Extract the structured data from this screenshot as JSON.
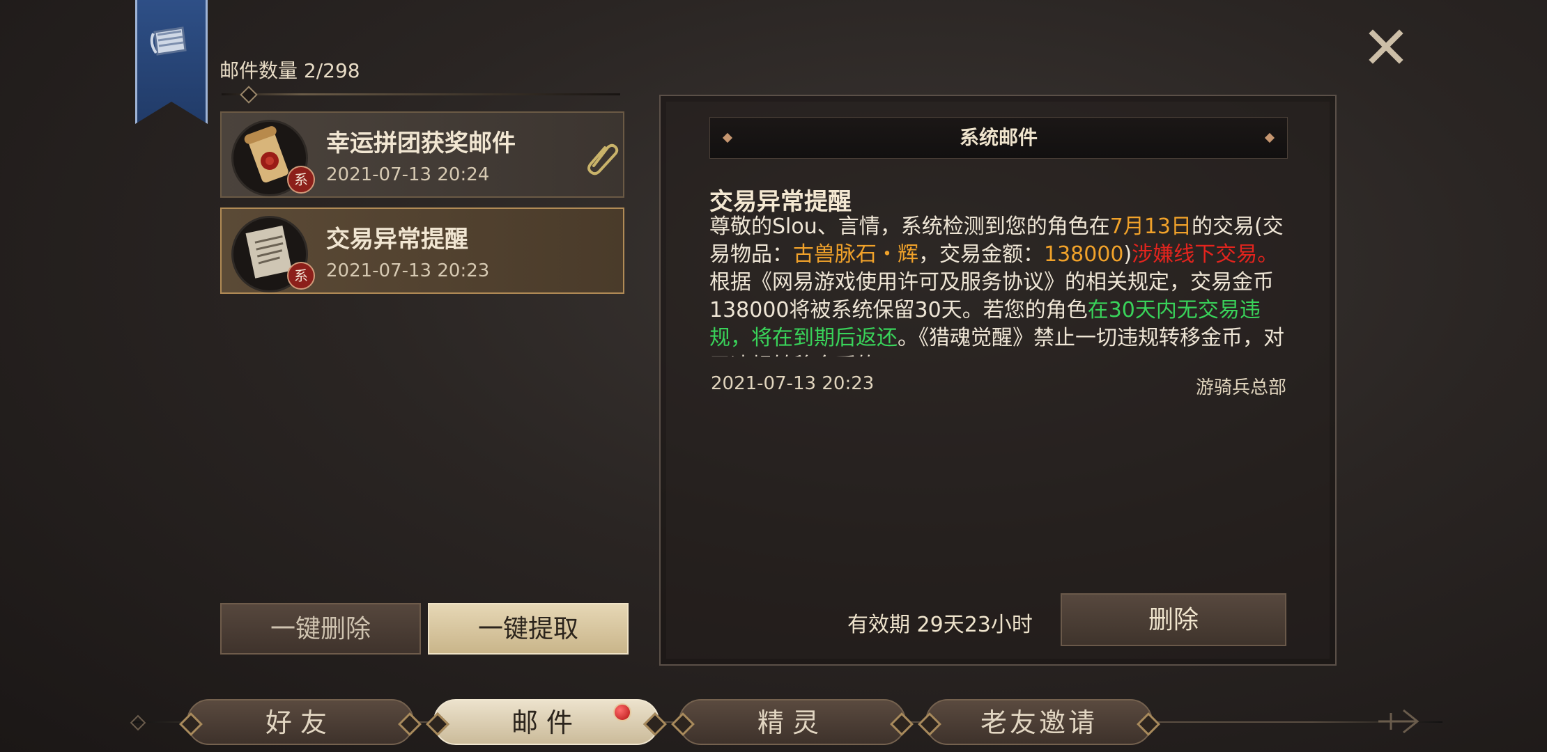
{
  "header": {
    "mail_count_label": "邮件数量",
    "mail_count_value": "2/298"
  },
  "mail_list": [
    {
      "title": "幸运拼团获奖邮件",
      "date": "2021-07-13 20:24",
      "badge": "系",
      "has_attachment": true,
      "icon": "scroll-wax-seal-icon"
    },
    {
      "title": "交易异常提醒",
      "date": "2021-07-13 20:23",
      "badge": "系",
      "has_attachment": false,
      "icon": "letter-parchment-icon",
      "selected": true
    }
  ],
  "list_buttons": {
    "delete_all": "一键删除",
    "collect_all": "一键提取"
  },
  "detail": {
    "header": "系统邮件",
    "title": "交易异常提醒",
    "body_segments": [
      {
        "text": "尊敬的Slou、言情，系统检测到您的角色在",
        "color": "normal"
      },
      {
        "text": "7月13日",
        "color": "orange"
      },
      {
        "text": "的交易(交易物品：",
        "color": "normal"
      },
      {
        "text": "古兽脉石・辉",
        "color": "orange"
      },
      {
        "text": "，交易金额：",
        "color": "normal"
      },
      {
        "text": "138000",
        "color": "orange"
      },
      {
        "text": ")",
        "color": "normal"
      },
      {
        "text": "涉嫌线下交易。",
        "color": "red"
      },
      {
        "text": "根据《网易游戏使用许可及服务协议》的相关规定，交易金币138000将被系统保留30天。若您的角色",
        "color": "normal"
      },
      {
        "text": "在30天内无交易违规，将在到期后返还",
        "color": "green"
      },
      {
        "text": "。《猎魂觉醒》禁止一切违规转移金币，对于违规转移金币的",
        "color": "normal"
      }
    ],
    "date": "2021-07-13 20:23",
    "sender": "游骑兵总部",
    "validity_label": "有效期",
    "validity_value": "29天23小时",
    "delete_label": "删除"
  },
  "tabs": [
    {
      "label": "好友",
      "active": false
    },
    {
      "label": "邮件",
      "active": true,
      "notify": true
    },
    {
      "label": "精灵",
      "active": false
    },
    {
      "label": "老友邀请",
      "active": false
    }
  ],
  "colors": {
    "highlight_orange": "#f1a22a",
    "highlight_red": "#e3241e",
    "highlight_green": "#39d35a",
    "banner_blue": "#2e4f86"
  }
}
